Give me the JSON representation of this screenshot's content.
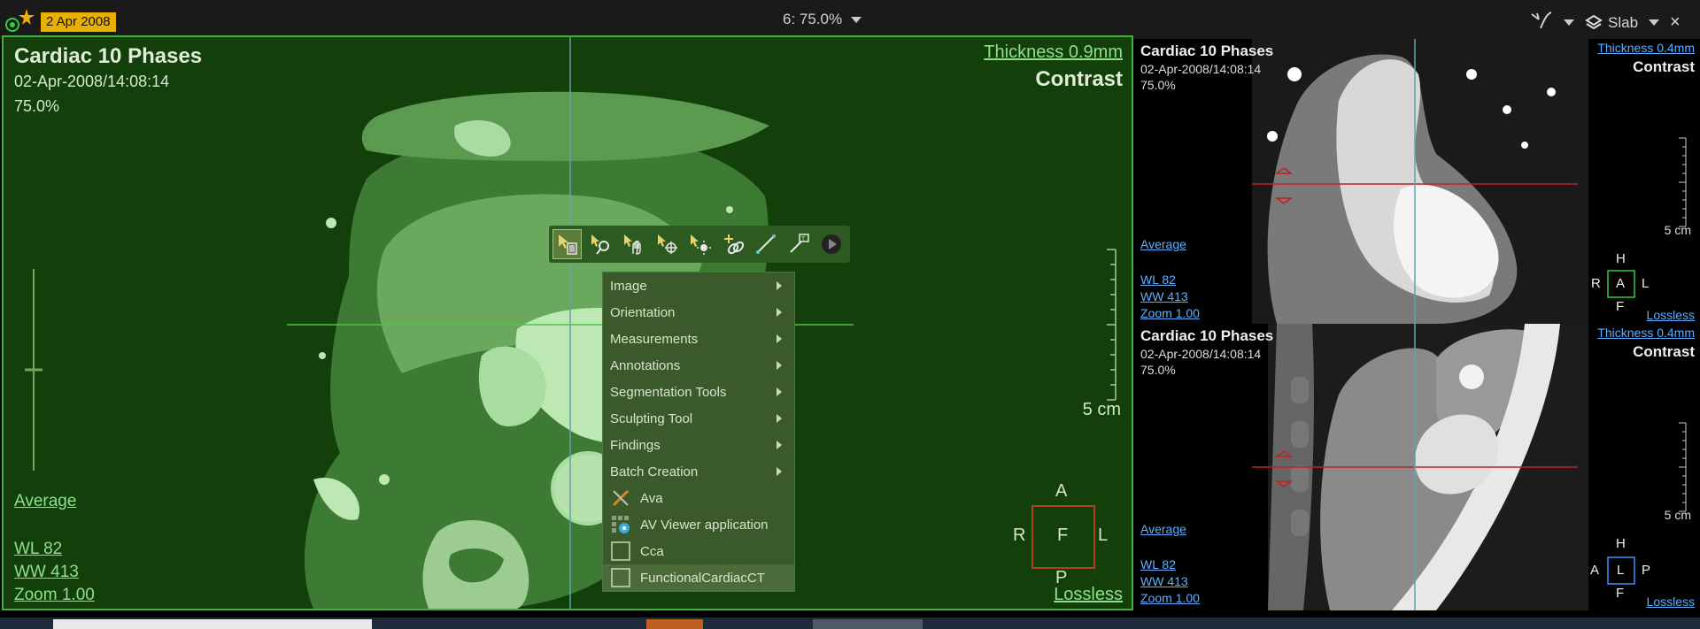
{
  "topbar": {
    "date": "2 Apr 2008",
    "zoom": "6: 75.0%",
    "slab": "Slab",
    "close": "×"
  },
  "main": {
    "title": "Cardiac 10 Phases",
    "date": "02-Apr-2008/14:08:14",
    "pct": "75.0%",
    "thickness": "Thickness 0.9mm",
    "contrast": "Contrast",
    "average": "Average",
    "wl": "WL    82",
    "ww": "WW    413",
    "zoom": "Zoom 1.00",
    "scale": "5 cm",
    "lossless": "Lossless",
    "orient": {
      "top": "A",
      "left": "R",
      "center": "F",
      "right": "L",
      "bottom": "P"
    }
  },
  "side_top": {
    "title": "Cardiac 10 Phases",
    "date": "02-Apr-2008/14:08:14",
    "pct": "75.0%",
    "thickness": "Thickness 0.4mm",
    "contrast": "Contrast",
    "average": "Average",
    "wl": "WL    82",
    "ww": "WW    413",
    "zoom": "Zoom 1.00",
    "scale": "5 cm",
    "lossless": "Lossless",
    "orient": {
      "top": "H",
      "left": "R",
      "center": "A",
      "right": "L",
      "bottom": "F"
    }
  },
  "side_bottom": {
    "title": "Cardiac 10 Phases",
    "date": "02-Apr-2008/14:08:14",
    "pct": "75.0%",
    "thickness": "Thickness 0.4mm",
    "contrast": "Contrast",
    "average": "Average",
    "wl": "WL    82",
    "ww": "WW    413",
    "zoom": "Zoom 1.00",
    "scale": "5 cm",
    "lossless": "Lossless",
    "orient": {
      "top": "H",
      "left": "A",
      "center": "L",
      "right": "P",
      "bottom": "F"
    }
  },
  "toolbar_icons": [
    "select-icon",
    "zoom-icon",
    "pan-icon",
    "rotate-icon",
    "window-level-icon",
    "link-icon",
    "measure-line-icon",
    "annotate-icon",
    "play-icon"
  ],
  "menu": {
    "items": [
      {
        "label": "Image"
      },
      {
        "label": "Orientation"
      },
      {
        "label": "Measurements"
      },
      {
        "label": "Annotations"
      },
      {
        "label": "Segmentation Tools"
      },
      {
        "label": "Sculpting Tool"
      },
      {
        "label": "Findings"
      },
      {
        "label": "Batch Creation"
      },
      {
        "label": "Ava"
      },
      {
        "label": "AV Viewer application"
      },
      {
        "label": "Cca"
      },
      {
        "label": "FunctionalCardiacCT"
      }
    ]
  },
  "colors": {
    "accent_green": "#3fb03a",
    "date_badge": "#e8b000",
    "link_blue": "#5eb0ff"
  }
}
